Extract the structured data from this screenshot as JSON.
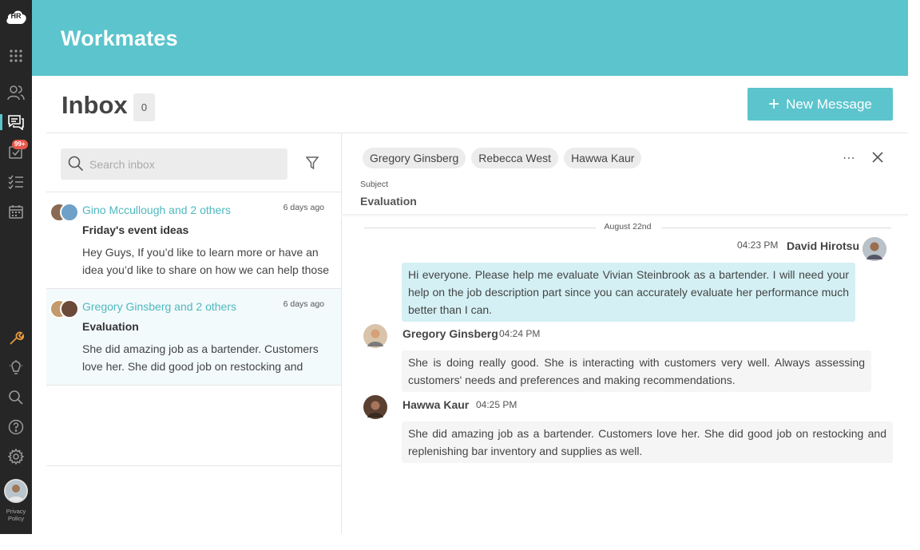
{
  "app": {
    "logo_text": "HR",
    "brand": "Workmates",
    "privacy_label": "Privacy Policy",
    "notification_badge": "99+",
    "accent_color": "#5bc4cc"
  },
  "rail": {
    "icons": [
      "apps-grid-icon",
      "people-icon",
      "messages-icon",
      "tasks-badge-icon",
      "checklist-icon",
      "calendar-icon",
      "wrench-icon",
      "lightbulb-icon",
      "search-icon",
      "help-icon",
      "settings-icon"
    ]
  },
  "inbox": {
    "title": "Inbox",
    "count": "0",
    "new_message_label": "New Message",
    "search_placeholder": "Search inbox",
    "threads": [
      {
        "participants": "Gino Mccullough and 2 others",
        "time": "6 days ago",
        "subject": "Friday's event ideas",
        "preview": "Hey Guys, If you’d like to learn more or have an idea you’d like to share on how we can help those"
      },
      {
        "participants": "Gregory Ginsberg and 2 others",
        "time": "6 days ago",
        "subject": "Evaluation",
        "preview": "She did amazing job as a bartender. Customers love her. She did good job on restocking and"
      }
    ]
  },
  "conversation": {
    "recipients": [
      "Gregory Ginsberg",
      "Rebecca West",
      "Hawwa Kaur"
    ],
    "subject_label": "Subject",
    "subject": "Evaluation",
    "date": "August 22nd",
    "messages": [
      {
        "author": "David Hirotsu",
        "time": "04:23 PM",
        "text": "Hi everyone. Please help me evaluate Vivian Steinbrook as a bartender. I will need your help on the job description part since you can accurately evaluate her performance much better than I can."
      },
      {
        "author": "Gregory Ginsberg",
        "time": "04:24 PM",
        "text": "She is doing really good. She is interacting with customers very well. Always assessing customers' needs and preferences and making recommendations."
      },
      {
        "author": "Hawwa Kaur",
        "time": "04:25 PM",
        "text": "She did amazing job as a bartender. Customers love her. She did good job on restocking and replenishing bar inventory and supplies as well."
      }
    ]
  }
}
